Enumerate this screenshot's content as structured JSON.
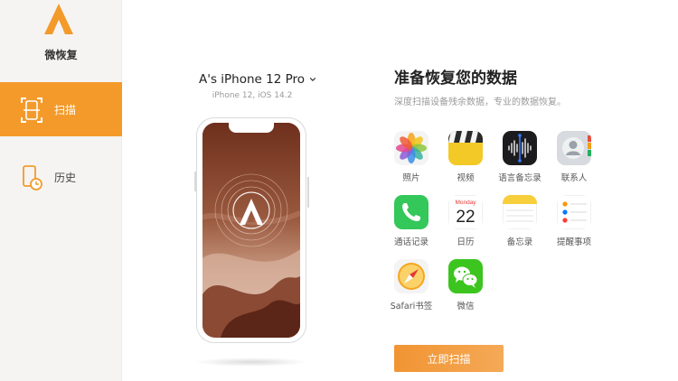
{
  "app": {
    "name": "微恢复"
  },
  "sidebar": {
    "items": [
      {
        "label": "扫描",
        "active": true,
        "icon": "scan-phone-icon"
      },
      {
        "label": "历史",
        "active": false,
        "icon": "history-icon"
      }
    ]
  },
  "device": {
    "name": "A's iPhone 12 Pro",
    "subtitle": "iPhone 12, iOS 14.2"
  },
  "panel": {
    "title": "准备恢复您的数据",
    "subtitle": "深度扫描设备残余数据，专业的数据恢复。",
    "categories": [
      {
        "label": "照片",
        "icon": "photos-icon"
      },
      {
        "label": "视频",
        "icon": "video-clapper-icon"
      },
      {
        "label": "语言备忘录",
        "icon": "voice-memo-icon"
      },
      {
        "label": "联系人",
        "icon": "contacts-icon"
      },
      {
        "label": "通话记录",
        "icon": "phone-icon"
      },
      {
        "label": "日历",
        "icon": "calendar-icon",
        "calendar_weekday": "Monday",
        "calendar_day": "22"
      },
      {
        "label": "备忘录",
        "icon": "notes-icon"
      },
      {
        "label": "提醒事项",
        "icon": "reminders-icon"
      },
      {
        "label": "Safari书签",
        "icon": "safari-icon"
      },
      {
        "label": "微信",
        "icon": "wechat-icon"
      }
    ],
    "scan_button": "立即扫描"
  },
  "colors": {
    "accent": "#f39a2b",
    "sidebar_bg": "#f5f4f2"
  }
}
